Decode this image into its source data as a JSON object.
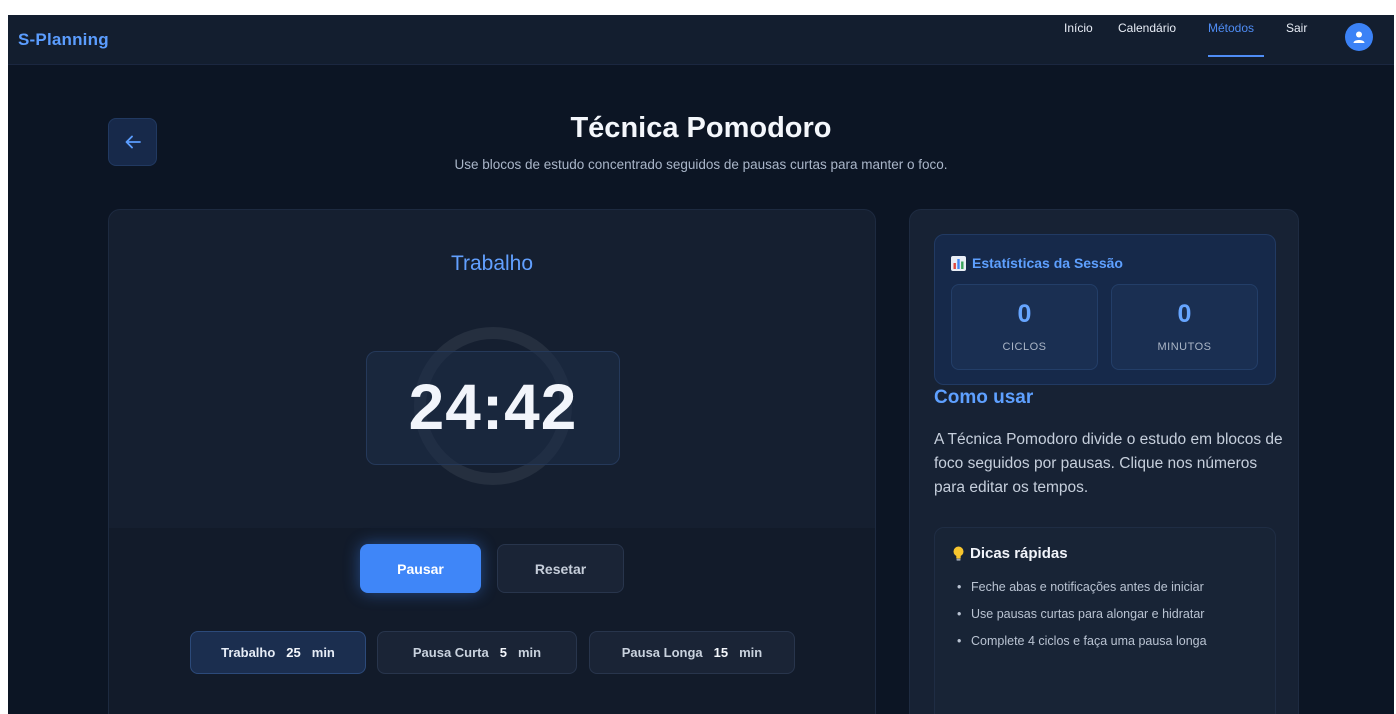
{
  "navbar": {
    "brand": "S-Planning",
    "links": [
      {
        "label": "Início",
        "active": false
      },
      {
        "label": "Calendário",
        "active": false
      },
      {
        "label": "Métodos",
        "active": true
      },
      {
        "label": "Sair",
        "active": false
      }
    ],
    "avatar_icon": "user-icon"
  },
  "header": {
    "back_icon": "arrow-left-icon",
    "title": "Técnica Pomodoro",
    "subtitle": "Use blocos de estudo concentrado seguidos de pausas curtas para manter o foco."
  },
  "timer": {
    "mode_label": "Trabalho",
    "time": "24:42",
    "pause_label": "Pausar",
    "reset_label": "Resetar",
    "durations": [
      {
        "label": "Trabalho",
        "value": "25",
        "unit": "min",
        "active": true
      },
      {
        "label": "Pausa Curta",
        "value": "5",
        "unit": "min",
        "active": false
      },
      {
        "label": "Pausa Longa",
        "value": "15",
        "unit": "min",
        "active": false
      }
    ]
  },
  "stats": {
    "icon": "bar-chart-icon",
    "title": "Estatísticas da Sessão",
    "items": [
      {
        "value": "0",
        "label": "CICLOS"
      },
      {
        "value": "0",
        "label": "MINUTOS"
      }
    ]
  },
  "howto": {
    "title": "Como usar",
    "text": "A Técnica Pomodoro divide o estudo em blocos de foco seguidos por pausas. Clique nos números para editar os tempos."
  },
  "tips": {
    "icon": "lightbulb-icon",
    "title": "Dicas rápidas",
    "items": [
      "Feche abas e notificações antes de iniciar",
      "Use pausas curtas para alongar e hidratar",
      "Complete 4 ciclos e faça uma pausa longa"
    ]
  },
  "colors": {
    "accent": "#3f86f8",
    "background": "#0c1524",
    "panel": "#151f30"
  }
}
